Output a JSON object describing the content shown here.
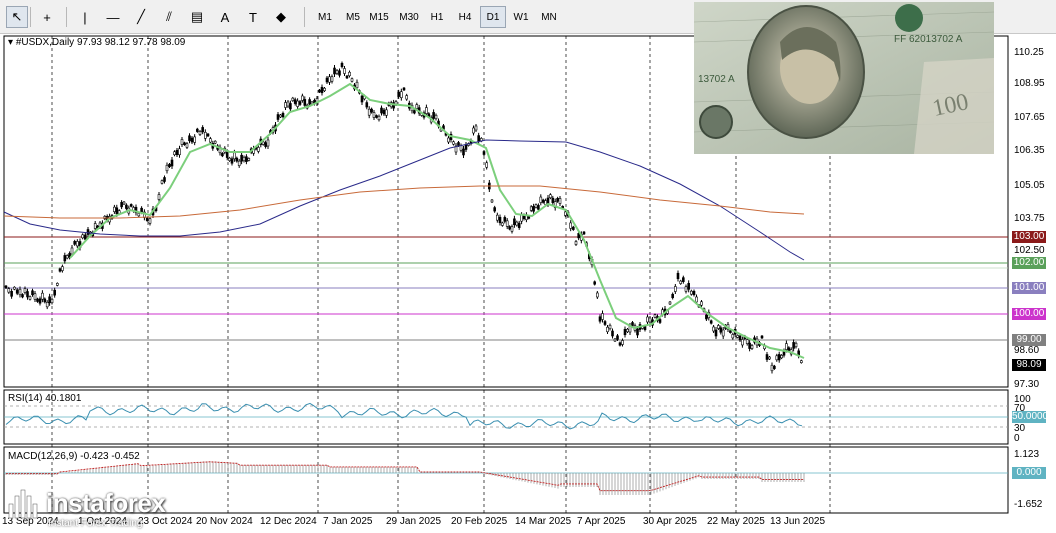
{
  "toolbar": {
    "tools": [
      {
        "name": "cursor-tool",
        "glyph": "↖"
      },
      {
        "name": "crosshair-tool",
        "glyph": "+"
      },
      {
        "name": "vertical-line-tool",
        "glyph": "|"
      },
      {
        "name": "horizontal-line-tool",
        "glyph": "—"
      },
      {
        "name": "trend-line-tool",
        "glyph": "╱"
      },
      {
        "name": "channel-tool",
        "glyph": "⫽"
      },
      {
        "name": "fibonacci-tool",
        "glyph": "▤"
      },
      {
        "name": "text-tool",
        "glyph": "A"
      },
      {
        "name": "text-label-tool",
        "glyph": "T"
      },
      {
        "name": "shapes-tool",
        "glyph": "◆"
      }
    ],
    "timeframes": [
      "M1",
      "M5",
      "M15",
      "M30",
      "H1",
      "H4",
      "D1",
      "W1",
      "MN"
    ],
    "active_timeframe": "D1"
  },
  "symbol_info": "#USDX,Daily  97.93 98.12 97.78 98.09",
  "indicators": {
    "rsi_label": "RSI(14) 40.1801",
    "macd_label": "MACD(12,26,9) -0.423 -0.452"
  },
  "price_axis": [
    "110.25",
    "108.95",
    "107.65",
    "106.35",
    "105.05",
    "103.75",
    "102.50",
    "98.60",
    "97.30"
  ],
  "rsi_axis": [
    "100",
    "70",
    "30",
    "0"
  ],
  "macd_axis": [
    "1.123",
    "-1.652"
  ],
  "badges": [
    {
      "label": "103.00",
      "color": "#8b1a1a"
    },
    {
      "label": "102.00",
      "color": "#5aa05a"
    },
    {
      "label": "101.00",
      "color": "#8a7fbf"
    },
    {
      "label": "100.00",
      "color": "#cc33cc"
    },
    {
      "label": "99.00",
      "color": "#808080"
    },
    {
      "label": "98.09",
      "color": "#000000"
    },
    {
      "label": "50.0000",
      "color": "#5fb3c2"
    },
    {
      "label": "0.000",
      "color": "#5fb3c2"
    }
  ],
  "dates": [
    "13 Sep 2024",
    "1 Oct 2024",
    "23 Oct 2024",
    "20 Nov 2024",
    "12 Dec 2024",
    "7 Jan 2025",
    "29 Jan 2025",
    "20 Feb 2025",
    "14 Mar 2025",
    "7 Apr 2025",
    "30 Apr 2025",
    "22 May 2025",
    "13 Jun 2025"
  ],
  "watermark": {
    "brand": "instaforex",
    "tagline": "Instant Forex Trading"
  },
  "colors": {
    "ma_fast": "#7ccf7c",
    "ma_mid": "#c86a3a",
    "ma_slow": "#2a2a8a",
    "rsi": "#3a8fb0",
    "macd_signal": "#c02020",
    "candle": "#000000"
  }
}
